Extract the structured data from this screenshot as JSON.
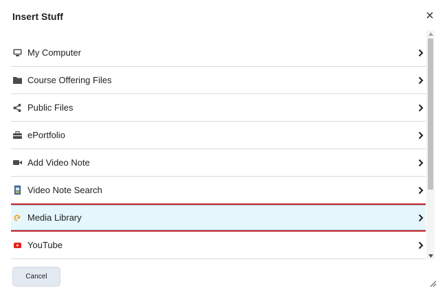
{
  "dialog": {
    "title": "Insert Stuff",
    "close_glyph": "×",
    "cancel_label": "Cancel"
  },
  "items": [
    {
      "label": "My Computer",
      "icon": "monitor-icon"
    },
    {
      "label": "Course Offering Files",
      "icon": "folder-icon"
    },
    {
      "label": "Public Files",
      "icon": "share-icon"
    },
    {
      "label": "ePortfolio",
      "icon": "briefcase-icon"
    },
    {
      "label": "Add Video Note",
      "icon": "video-camera-icon"
    },
    {
      "label": "Video Note Search",
      "icon": "video-note-icon"
    },
    {
      "label": "Media Library",
      "icon": "media-library-icon",
      "selected": true
    },
    {
      "label": "YouTube",
      "icon": "youtube-icon"
    }
  ],
  "colors": {
    "selected_bg": "#e6f6fd",
    "highlight_border": "#c22026",
    "divider": "#d3d9e3",
    "youtube_red": "#e62117",
    "media_orange": "#f2a024"
  }
}
